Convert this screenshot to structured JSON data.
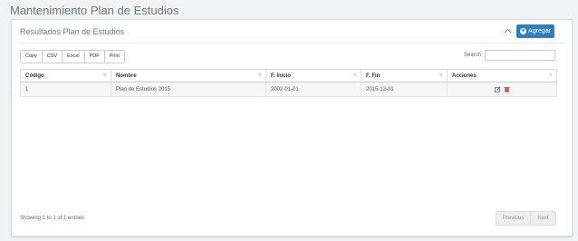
{
  "page_title": "Mantenimiento Plan de Estudios",
  "panel": {
    "title": "Resultados Plan de Estudios",
    "add_label": "Agregar"
  },
  "export_buttons": [
    "Copy",
    "CSV",
    "Excel",
    "PDF",
    "Print"
  ],
  "search": {
    "label": "Search:",
    "value": ""
  },
  "table": {
    "columns": [
      "Código",
      "Nombre",
      "F. Inicio",
      "F. Fin",
      "Acciones"
    ],
    "rows": [
      [
        "1",
        "Plan de Estudios 2015",
        "2002-01-01",
        "2015-12-31"
      ]
    ]
  },
  "info_text": "Showing 1 to 1 of 1 entries",
  "pagination": {
    "prev": "Previous",
    "next": "Next"
  },
  "colors": {
    "accent": "#2f7ec2",
    "edit": "#2f7ec2",
    "delete": "#d9534f"
  },
  "icons": {
    "collapse": "chevron-up-icon",
    "add": "plus-circle-icon",
    "edit": "edit-icon",
    "delete": "trash-icon"
  }
}
